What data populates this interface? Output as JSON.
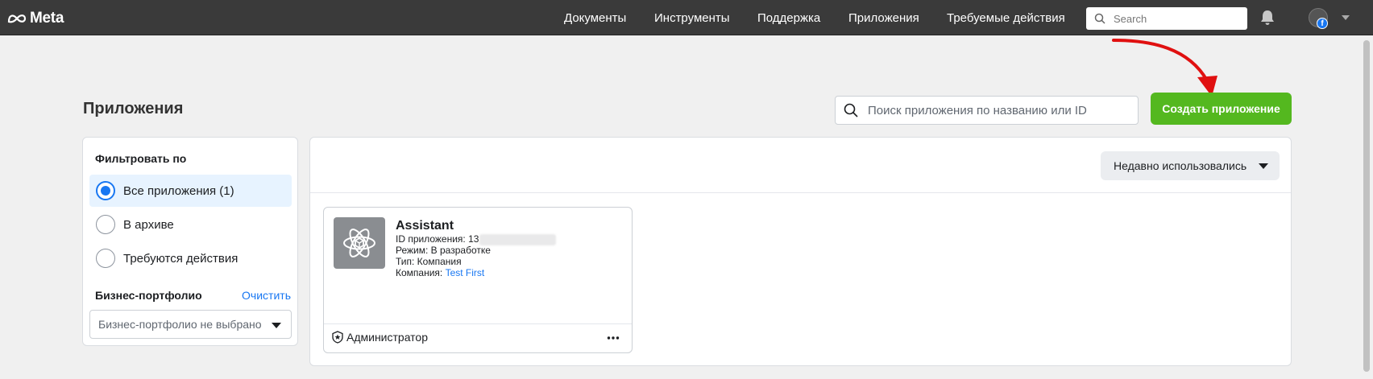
{
  "topbar": {
    "brand": "Meta",
    "nav": [
      {
        "label": "Документы"
      },
      {
        "label": "Инструменты"
      },
      {
        "label": "Поддержка"
      },
      {
        "label": "Приложения"
      },
      {
        "label": "Требуемые действия"
      }
    ],
    "search_placeholder": "Search",
    "icons": [
      "meta-logo-icon",
      "search-icon",
      "bell-icon",
      "facebook-icon",
      "chevron-down-icon"
    ]
  },
  "page": {
    "title": "Приложения",
    "search_placeholder": "Поиск приложения по названию или ID",
    "create_button": "Создать приложение",
    "accent_color": "#54b81f",
    "link_color": "#1877f2"
  },
  "filter": {
    "title": "Фильтровать по",
    "options": [
      {
        "label": "Все приложения (1)",
        "selected": true
      },
      {
        "label": "В архиве",
        "selected": false
      },
      {
        "label": "Требуются действия",
        "selected": false
      }
    ],
    "business_label": "Бизнес-портфолио",
    "clear_label": "Очистить",
    "business_placeholder": "Бизнес-портфолио не выбрано"
  },
  "main": {
    "sort_label": "Недавно использовались",
    "apps": [
      {
        "name": "Assistant",
        "id_label": "ID приложения:",
        "id_value": "13",
        "mode": "Режим: В разработке",
        "type": "Тип: Компания",
        "company_label": "Компания:",
        "company_value": "Test First",
        "role": "Администратор",
        "icon": "atom-icon"
      }
    ]
  }
}
